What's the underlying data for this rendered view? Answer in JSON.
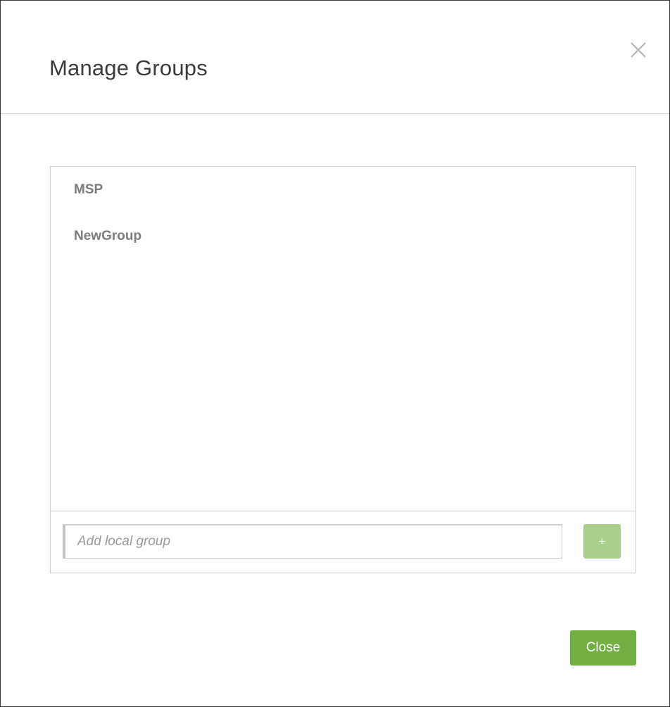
{
  "dialog": {
    "title": "Manage Groups",
    "close_icon": "close-icon",
    "close_icon_color": "#b5b5b5"
  },
  "groups": {
    "items": [
      {
        "label": "MSP"
      },
      {
        "label": "NewGroup"
      }
    ]
  },
  "add_group": {
    "placeholder": "Add local group",
    "value": "",
    "add_button_label": "+",
    "add_button_color": "#a9cf8c"
  },
  "footer": {
    "close_button_label": "Close",
    "close_button_color": "#72ae41"
  }
}
